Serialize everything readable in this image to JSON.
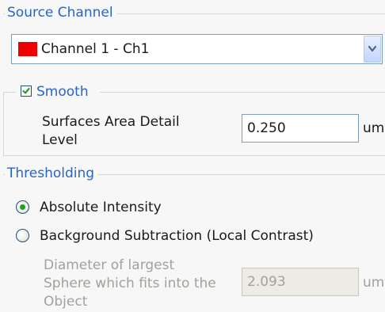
{
  "source_channel": {
    "title": "Source Channel",
    "selected": "Channel 1 - Ch1",
    "swatch_color": "#ee0000"
  },
  "smooth": {
    "title": "Smooth",
    "checked": true,
    "detail_label_line1": "Surfaces Area Detail",
    "detail_label_line2": "Level",
    "detail_value": "0.250",
    "detail_unit": "um"
  },
  "thresholding": {
    "title": "Thresholding",
    "option_absolute": "Absolute Intensity",
    "option_background": "Background Subtraction (Local Contrast)",
    "selected_option": "Absolute Intensity",
    "diameter_label_line1": "Diameter of largest",
    "diameter_label_line2": "Sphere which fits into the",
    "diameter_label_line3": "Object",
    "diameter_value": "2.093",
    "diameter_unit": "um"
  },
  "colors": {
    "group_title": "#2a64c8",
    "disabled_text": "#a4a09a",
    "check_mark": "#21a121"
  }
}
